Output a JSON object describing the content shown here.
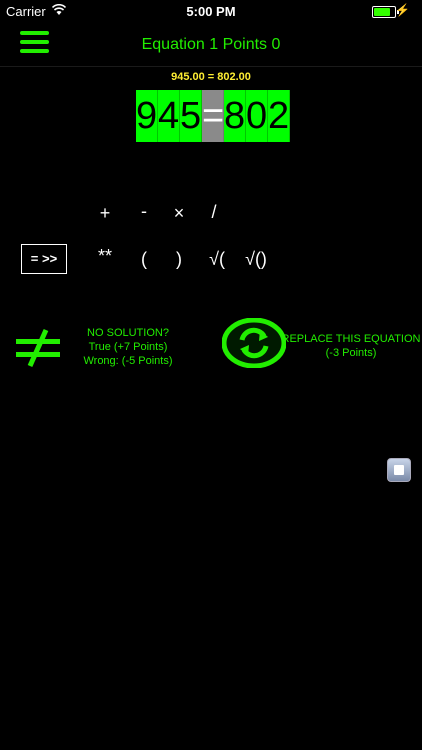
{
  "status": {
    "carrier": "Carrier",
    "time": "5:00 PM"
  },
  "header": {
    "title": "Equation 1  Points 0"
  },
  "equation": {
    "text": "945.00 = 802.00",
    "tiles": [
      "9",
      "4",
      "5",
      "=",
      "8",
      "0",
      "2"
    ]
  },
  "operators_row1": [
    "+",
    "-",
    "×",
    "/"
  ],
  "operators_row2": [
    "**",
    "(",
    ")",
    "√(",
    "√()"
  ],
  "equals_button": "= >>",
  "no_solution": {
    "line1": "NO SOLUTION?",
    "line2": "True (+7 Points)",
    "line3": "Wrong: (-5 Points)"
  },
  "replace": {
    "line1": "REPLACE THIS EQUATION",
    "line2": "(-3 Points)"
  },
  "colors": {
    "accent": "#22ee00",
    "tile": "#00ff00",
    "highlight": "#ffee33"
  }
}
